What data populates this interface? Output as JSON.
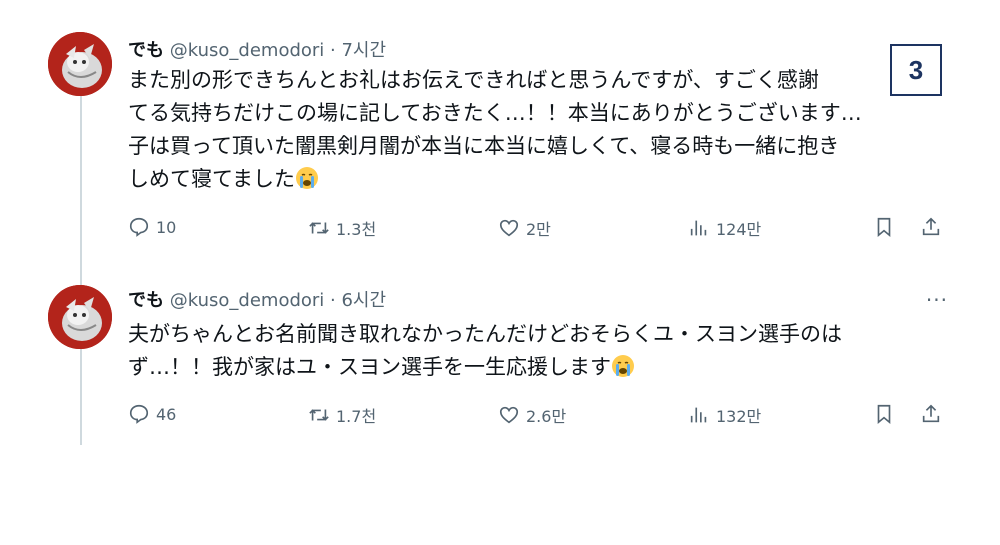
{
  "tweets": [
    {
      "display_name": "でも",
      "handle": "@kuso_demodori",
      "time": "· 7시간",
      "lines": [
        "また別の形できちんとお礼はお伝えできればと思うんですが、すごく感謝",
        "てる気持ちだけこの場に記しておきたく…！！本当にありがとうございます…",
        "子は買って頂いた闇黒剣月闇が本当に本当に嬉しくて、寝る時も一緒に抱き",
        "しめて寝てました"
      ],
      "stats": {
        "replies": "10",
        "retweets": "1.3천",
        "likes": "2만",
        "views": "124만"
      }
    },
    {
      "display_name": "でも",
      "handle": "@kuso_demodori",
      "time": "· 6시간",
      "more": "···",
      "lines": [
        "夫がちゃんとお名前聞き取れなかったんだけどおそらくユ・スヨン選手のは",
        "ず…！！我が家はユ・スヨン選手を一生応援します"
      ],
      "stats": {
        "replies": "46",
        "retweets": "1.7천",
        "likes": "2.6만",
        "views": "132만"
      }
    }
  ],
  "badge": "3",
  "colors": {
    "text": "#0f1419",
    "muted": "#536471",
    "line": "#cfd9de",
    "badge": "#1d3461"
  },
  "icons": [
    "reply-icon",
    "retweet-icon",
    "like-icon",
    "views-icon",
    "bookmark-icon",
    "share-icon",
    "crying-emoji"
  ]
}
